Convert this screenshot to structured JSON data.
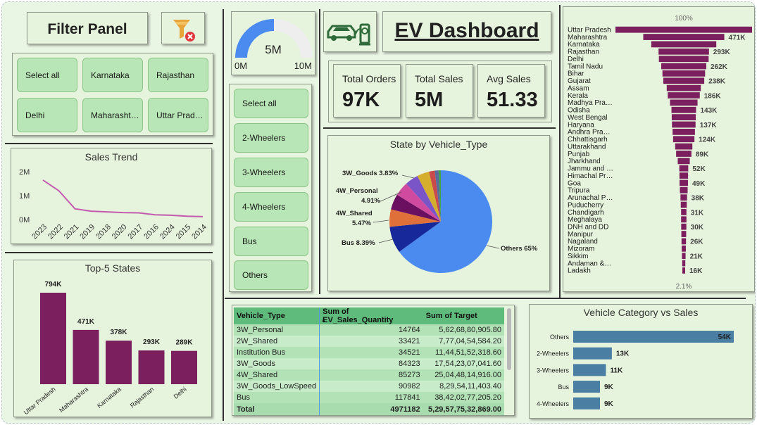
{
  "filter_panel": {
    "title": "Filter Panel",
    "clear_icon": "filter-clear-icon",
    "states": [
      "Select all",
      "Karnataka",
      "Rajasthan",
      "Delhi",
      "Maharasht…",
      "Uttar Prad…"
    ]
  },
  "gauge": {
    "value_label": "5M",
    "min_label": "0M",
    "max_label": "10M",
    "fill_fraction": 0.5,
    "color": "#4b8bf0"
  },
  "vehicle_slicer": {
    "items": [
      "Select all",
      "2-Wheelers",
      "3-Wheelers",
      "4-Wheelers",
      "Bus",
      "Others"
    ]
  },
  "header": {
    "title": "EV Dashboard",
    "icon": "ev-charging-car-icon"
  },
  "kpis": [
    {
      "label": "Total Orders",
      "value": "97K"
    },
    {
      "label": "Total Sales",
      "value": "5M"
    },
    {
      "label": "Avg Sales",
      "value": "51.33"
    }
  ],
  "sales_trend": {
    "title": "Sales Trend",
    "y_ticks": [
      "2M",
      "1M",
      "0M"
    ],
    "x_ticks": [
      "2023",
      "2022",
      "2021",
      "2019",
      "2018",
      "2020",
      "2017",
      "2016",
      "2024",
      "2015",
      "2014"
    ]
  },
  "top5": {
    "title": "Top-5 States",
    "categories": [
      "Uttar Pradesh",
      "Maharashtra",
      "Karnataka",
      "Rajasthan",
      "Delhi"
    ],
    "labels": [
      "794K",
      "471K",
      "378K",
      "293K",
      "289K"
    ]
  },
  "pie": {
    "title": "State by Vehicle_Type",
    "labels": [
      "3W_Goods 3.83%",
      "4W_Personal",
      "4.91%",
      "4W_Shared",
      "5.47%",
      "Bus 8.39%",
      "Others 65%"
    ]
  },
  "funnel": {
    "top_label": "100%",
    "bottom_label": "2.1%",
    "states": [
      "Uttar Pradesh",
      "Maharashtra",
      "Karnataka",
      "Rajasthan",
      "Delhi",
      "Tamil Nadu",
      "Bihar",
      "Gujarat",
      "Assam",
      "Kerala",
      "Madhya Pra…",
      "Odisha",
      "West Bengal",
      "Haryana",
      "Andhra Pra…",
      "Chhattisgarh",
      "Uttarakhand",
      "Punjab",
      "Jharkhand",
      "Jammu and …",
      "Himachal Pr…",
      "Goa",
      "Tripura",
      "Arunachal P…",
      "Puducherry",
      "Chandigarh",
      "Meghalaya",
      "DNH and DD",
      "Manipur",
      "Nagaland",
      "Mizoram",
      "Sikkim",
      "Andaman &…",
      "Ladakh"
    ],
    "value_labels": [
      "471K",
      "293K",
      "262K",
      "238K",
      "186K",
      "143K",
      "137K",
      "124K",
      "89K",
      "52K",
      "49K",
      "38K",
      "31K",
      "30K",
      "26K",
      "21K",
      "16K"
    ],
    "color": "#7b1f5e"
  },
  "table": {
    "headers": [
      "Vehicle_Type",
      "Sum of EV_Sales_Quantity",
      "Sum of Target"
    ],
    "rows": [
      [
        "3W_Personal",
        "14764",
        "5,62,68,80,905.80"
      ],
      [
        "2W_Shared",
        "33421",
        "7,77,04,54,584.20"
      ],
      [
        "Institution Bus",
        "34521",
        "11,44,51,52,318.60"
      ],
      [
        "3W_Goods",
        "84323",
        "17,54,23,07,041.60"
      ],
      [
        "4W_Shared",
        "85273",
        "25,04,48,14,916.00"
      ],
      [
        "3W_Goods_LowSpeed",
        "90982",
        "8,29,54,11,403.40"
      ],
      [
        "Bus",
        "117841",
        "38,42,02,77,205.20"
      ]
    ],
    "total": [
      "Total",
      "4971182",
      "5,29,57,75,32,869.00"
    ]
  },
  "vehicle_category": {
    "title": "Vehicle Category vs Sales",
    "categories": [
      "Others",
      "2-Wheelers",
      "3-Wheelers",
      "Bus",
      "4-Wheelers"
    ],
    "labels": [
      "54K",
      "13K",
      "11K",
      "9K",
      "9K"
    ],
    "color": "#4a7fa3"
  },
  "chart_data": [
    {
      "type": "line",
      "title": "Sales Trend",
      "x": [
        "2023",
        "2022",
        "2021",
        "2019",
        "2018",
        "2020",
        "2017",
        "2016",
        "2024",
        "2015",
        "2014"
      ],
      "values": [
        1.65,
        1.2,
        0.45,
        0.35,
        0.32,
        0.29,
        0.28,
        0.2,
        0.18,
        0.14,
        0.12
      ],
      "ylim": [
        0,
        2
      ],
      "y_unit": "M",
      "color": "#c45bb0"
    },
    {
      "type": "bar",
      "title": "Top-5 States",
      "categories": [
        "Uttar Pradesh",
        "Maharashtra",
        "Karnataka",
        "Rajasthan",
        "Delhi"
      ],
      "values": [
        794,
        471,
        378,
        293,
        289
      ],
      "unit": "K",
      "color": "#7b1f5e"
    },
    {
      "type": "pie",
      "title": "State by Vehicle_Type",
      "slices": [
        {
          "label": "Others",
          "value": 65.0,
          "color": "#4b8bf0"
        },
        {
          "label": "Bus",
          "value": 8.39,
          "color": "#17289a"
        },
        {
          "label": "4W_Shared",
          "value": 5.47,
          "color": "#e0703a"
        },
        {
          "label": "4W_Personal",
          "value": 4.91,
          "color": "#6b1060"
        },
        {
          "label": "slice5",
          "value": 4.5,
          "color": "#d04aa0"
        },
        {
          "label": "slice6",
          "value": 4.2,
          "color": "#7a55c8"
        },
        {
          "label": "3W_Goods",
          "value": 3.83,
          "color": "#d6ae2e"
        },
        {
          "label": "slice8",
          "value": 1.8,
          "color": "#c94a4a"
        },
        {
          "label": "slice9",
          "value": 1.2,
          "color": "#5a6a9a"
        },
        {
          "label": "slice10",
          "value": 0.7,
          "color": "#3fa34d"
        }
      ]
    },
    {
      "type": "bar",
      "title": "Vehicle Category vs Sales",
      "orientation": "horizontal",
      "categories": [
        "Others",
        "2-Wheelers",
        "3-Wheelers",
        "Bus",
        "4-Wheelers"
      ],
      "values": [
        54,
        13,
        11,
        9,
        9
      ],
      "unit": "K"
    },
    {
      "type": "bar",
      "title": "",
      "orientation": "funnel",
      "categories": [
        "Uttar Pradesh",
        "Maharashtra",
        "Karnataka",
        "Rajasthan",
        "Delhi",
        "Tamil Nadu",
        "Bihar",
        "Gujarat",
        "Assam",
        "Kerala",
        "Madhya Pra…",
        "Odisha",
        "West Bengal",
        "Haryana",
        "Andhra Pra…",
        "Chhattisgarh",
        "Uttarakhand",
        "Punjab",
        "Jharkhand",
        "Jammu and …",
        "Himachal Pr…",
        "Goa",
        "Tripura",
        "Arunachal P…",
        "Puducherry",
        "Chandigarh",
        "Meghalaya",
        "DNH and DD",
        "Manipur",
        "Nagaland",
        "Mizoram",
        "Sikkim",
        "Andaman &…",
        "Ladakh"
      ],
      "values": [
        794,
        471,
        378,
        293,
        289,
        262,
        248,
        238,
        198,
        186,
        160,
        143,
        140,
        137,
        130,
        124,
        100,
        89,
        70,
        52,
        50,
        49,
        45,
        38,
        35,
        31,
        31,
        30,
        28,
        26,
        24,
        21,
        18,
        16
      ],
      "unit": "K"
    }
  ]
}
